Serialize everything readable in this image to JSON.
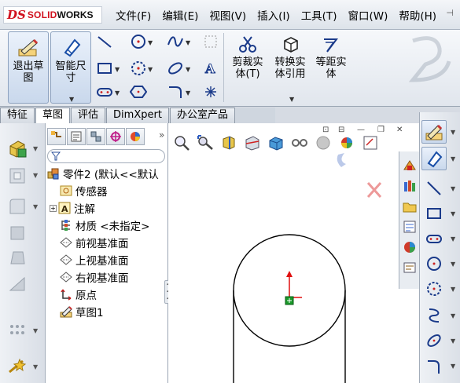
{
  "app": {
    "logo_prefix": "DS",
    "logo_solid": "SOLID",
    "logo_works": "WORKS"
  },
  "menu": {
    "items": [
      "文件(F)",
      "编辑(E)",
      "视图(V)",
      "插入(I)",
      "工具(T)",
      "窗口(W)",
      "帮助(H)"
    ],
    "pin": "⊣"
  },
  "command_manager": {
    "exit_sketch_label": "退出草\n图",
    "smart_dimension_label": "智能尺\n寸",
    "trim_label": "剪裁实\n体(T)",
    "convert_label": "转换实\n体引用",
    "offset_label": "等距实\n体"
  },
  "tabs": [
    "特征",
    "草图",
    "评估",
    "DimXpert",
    "办公室产品"
  ],
  "active_tab": "草图",
  "feature_tree": {
    "part": "零件2 (默认<<默认",
    "items": [
      {
        "label": "传感器",
        "icon": "sensor-icon"
      },
      {
        "label": "注解",
        "icon": "annotation-icon"
      },
      {
        "label": "材质 <未指定>",
        "icon": "material-icon"
      },
      {
        "label": "前视基准面",
        "icon": "plane-icon"
      },
      {
        "label": "上视基准面",
        "icon": "plane-icon"
      },
      {
        "label": "右视基准面",
        "icon": "plane-icon"
      },
      {
        "label": "原点",
        "icon": "origin-icon"
      },
      {
        "label": "草图1",
        "icon": "sketch-icon"
      }
    ]
  },
  "colors": {
    "accent": "#d1121f",
    "sketch_line": "#000000",
    "origin_red": "#e01010",
    "origin_green": "#1a9a2a"
  }
}
